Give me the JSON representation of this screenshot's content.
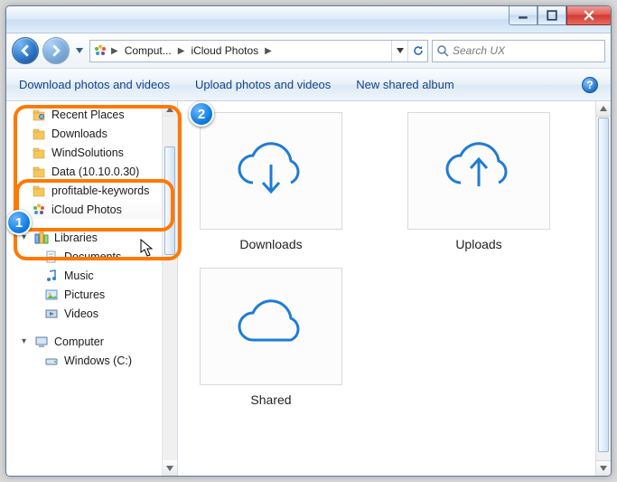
{
  "titlebar": {
    "min_label": "Minimize",
    "max_label": "Maximize",
    "close_label": "Close"
  },
  "breadcrumbs": {
    "root": "Comput...",
    "current": "iCloud Photos"
  },
  "search": {
    "placeholder": "Search UX"
  },
  "commands": {
    "download": "Download photos and videos",
    "upload": "Upload photos and videos",
    "newalbum": "New shared album"
  },
  "sidebar": {
    "recent": "Recent Places",
    "downloads": "Downloads",
    "winds": "WindSolutions",
    "data": "Data (10.10.0.30)",
    "profitable": "profitable-keywords",
    "icloud": "iCloud Photos",
    "libraries": "Libraries",
    "documents": "Documents",
    "music": "Music",
    "pictures": "Pictures",
    "videos": "Videos",
    "computer": "Computer",
    "cdrive": "Windows (C:)"
  },
  "tiles": {
    "downloads": "Downloads",
    "uploads": "Uploads",
    "shared": "Shared"
  },
  "annotations": {
    "one": "1",
    "two": "2"
  }
}
